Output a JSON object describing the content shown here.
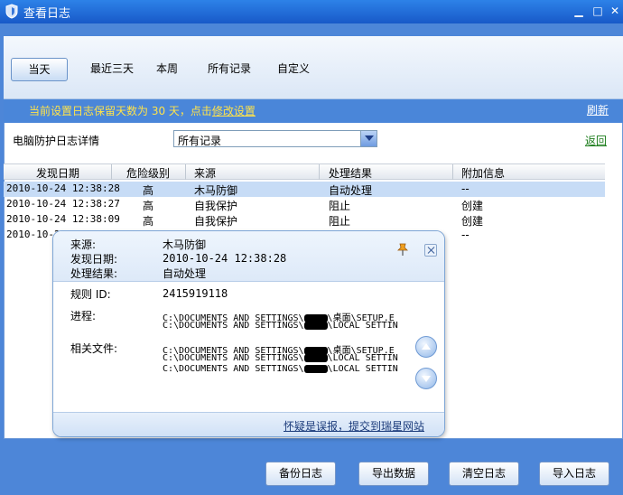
{
  "window": {
    "title": "查看日志",
    "min_glyph": "▁",
    "max_glyph": "□",
    "close_glyph": "✕"
  },
  "tabs": [
    {
      "label": "当天",
      "active": true
    },
    {
      "label": "最近三天",
      "active": false
    },
    {
      "label": "本周",
      "active": false
    },
    {
      "label": "所有记录",
      "active": false
    },
    {
      "label": "自定义",
      "active": false
    }
  ],
  "notice": {
    "text": "当前设置日志保留天数为 30 天，点击",
    "link": "修改设置",
    "refresh": "刷新"
  },
  "filter": {
    "label": "电脑防护日志详情",
    "selected": "所有记录",
    "back": "返回"
  },
  "table": {
    "columns": [
      "发现日期",
      "危险级别",
      "来源",
      "处理结果",
      "附加信息"
    ],
    "rows": [
      {
        "date": "2010-10-24 12:38:28",
        "level": "高",
        "source": "木马防御",
        "result": "自动处理",
        "extra": "--",
        "selected": true
      },
      {
        "date": "2010-10-24 12:38:27",
        "level": "高",
        "source": "自我保护",
        "result": "阻止",
        "extra": "创建",
        "selected": false
      },
      {
        "date": "2010-10-24 12:38:09",
        "level": "高",
        "source": "自我保护",
        "result": "阻止",
        "extra": "创建",
        "selected": false
      },
      {
        "date": "2010-10-2",
        "level": "",
        "source": "",
        "result": "",
        "extra": "--",
        "selected": false
      }
    ]
  },
  "popup": {
    "source_label": "来源:",
    "source": "木马防御",
    "date_label": "发现日期:",
    "date": "2010-10-24 12:38:28",
    "result_label": "处理结果:",
    "result": "自动处理",
    "rule_label": "规则 ID:",
    "rule_id": "2415919118",
    "process_label": "进程:",
    "process_lines": [
      {
        "pre": "C:\\DOCUMENTS AND SETTINGS\\",
        "post": "\\桌面\\SETUP.E"
      },
      {
        "pre": "C:\\DOCUMENTS AND SETTINGS\\",
        "post": "\\LOCAL SETTIN"
      }
    ],
    "files_label": "相关文件:",
    "file_lines": [
      {
        "pre": "C:\\DOCUMENTS AND SETTINGS\\",
        "post": "\\桌面\\SETUP.E"
      },
      {
        "pre": "C:\\DOCUMENTS AND SETTINGS\\",
        "post": "\\LOCAL SETTIN"
      },
      {
        "pre": "C:\\DOCUMENTS AND SETTINGS\\",
        "post": "\\LOCAL SETTIN"
      }
    ],
    "report_link": "怀疑是误报，提交到瑞星网站"
  },
  "buttons": {
    "backup": "备份日志",
    "export": "导出数据",
    "clear": "清空日志",
    "import": "导入日志"
  },
  "colors": {
    "notice_text": "#ffe34a",
    "back_link": "#1c7d1c",
    "frame": "#4d86d8",
    "selected_row": "#c7dcf6"
  }
}
